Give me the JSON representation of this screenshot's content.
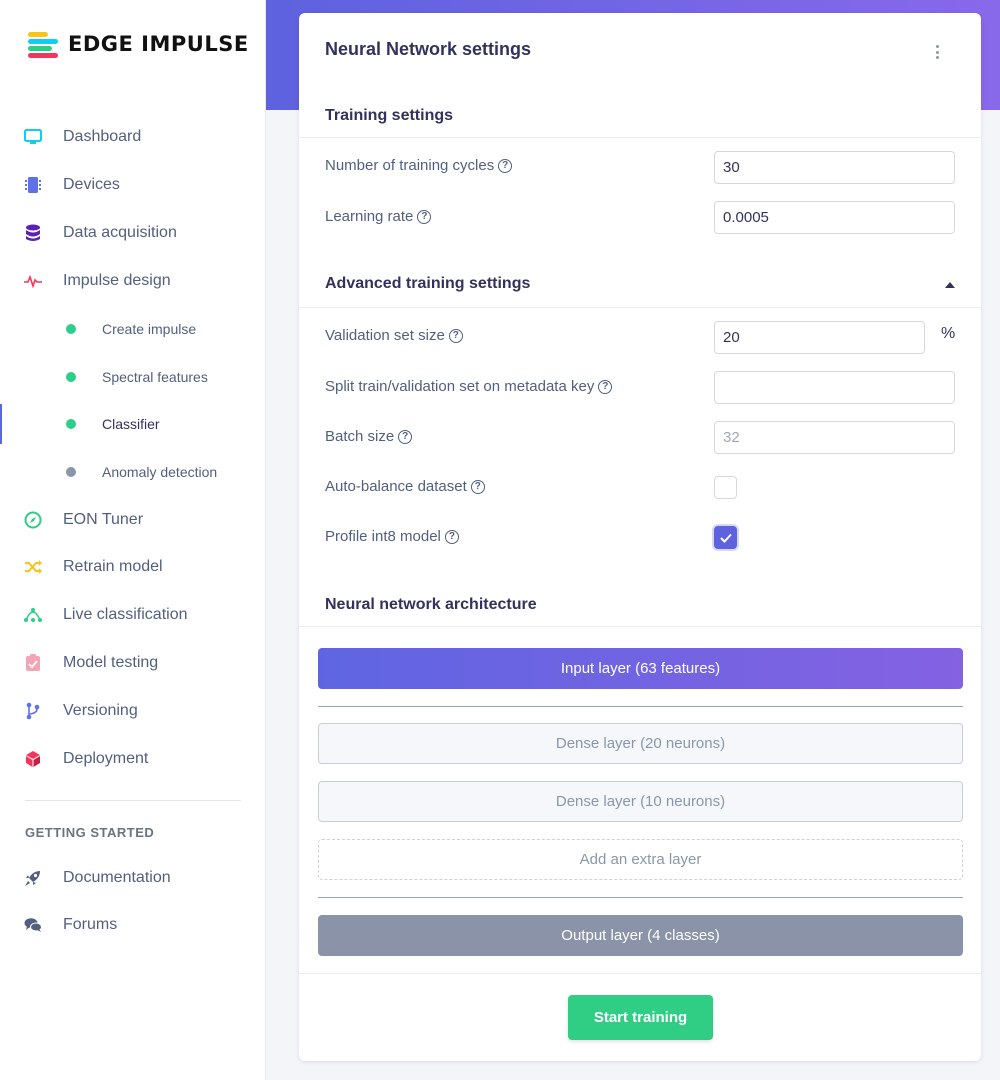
{
  "brand": {
    "name": "EDGE IMPULSE"
  },
  "sidebar": {
    "items": [
      {
        "label": "Dashboard",
        "icon": "monitor-icon",
        "color": "#11cdef"
      },
      {
        "label": "Devices",
        "icon": "chip-icon",
        "color": "#5e72e4"
      },
      {
        "label": "Data acquisition",
        "icon": "database-icon",
        "color": "#5b21b6"
      },
      {
        "label": "Impulse design",
        "icon": "pulse-icon",
        "color": "#f5365c"
      }
    ],
    "subitems": [
      {
        "label": "Create impulse",
        "status_color": "#2dce89"
      },
      {
        "label": "Spectral features",
        "status_color": "#2dce89"
      },
      {
        "label": "Classifier",
        "status_color": "#2dce89",
        "active": true
      },
      {
        "label": "Anomaly detection",
        "status_color": "#8898aa"
      }
    ],
    "items2": [
      {
        "label": "EON Tuner",
        "icon": "compass-icon",
        "color": "#2dce89"
      },
      {
        "label": "Retrain model",
        "icon": "shuffle-icon",
        "color": "#f5c518"
      },
      {
        "label": "Live classification",
        "icon": "network-icon",
        "color": "#2dce89"
      },
      {
        "label": "Model testing",
        "icon": "clipboard-check-icon",
        "color": "#f3a4b5"
      },
      {
        "label": "Versioning",
        "icon": "branch-icon",
        "color": "#5e72e4"
      },
      {
        "label": "Deployment",
        "icon": "cube-icon",
        "color": "#f5365c"
      }
    ],
    "getting_started": {
      "heading": "GETTING STARTED",
      "items": [
        {
          "label": "Documentation",
          "icon": "rocket-icon"
        },
        {
          "label": "Forums",
          "icon": "comments-icon"
        }
      ]
    }
  },
  "card": {
    "title": "Neural Network settings",
    "training": {
      "title": "Training settings",
      "cycles_label": "Number of training cycles",
      "cycles_value": "30",
      "lr_label": "Learning rate",
      "lr_value": "0.0005"
    },
    "advanced": {
      "title": "Advanced training settings",
      "validation_label": "Validation set size",
      "validation_value": "20",
      "validation_unit": "%",
      "split_label": "Split train/validation set on metadata key",
      "split_value": "",
      "batch_label": "Batch size",
      "batch_placeholder": "32",
      "balance_label": "Auto-balance dataset",
      "balance_checked": false,
      "profile_label": "Profile int8 model",
      "profile_checked": true
    },
    "architecture": {
      "title": "Neural network architecture",
      "input_layer": "Input layer (63 features)",
      "dense1": "Dense layer (20 neurons)",
      "dense2": "Dense layer (10 neurons)",
      "add_layer": "Add an extra layer",
      "output_layer": "Output layer (4 classes)"
    },
    "start_button": "Start training"
  }
}
